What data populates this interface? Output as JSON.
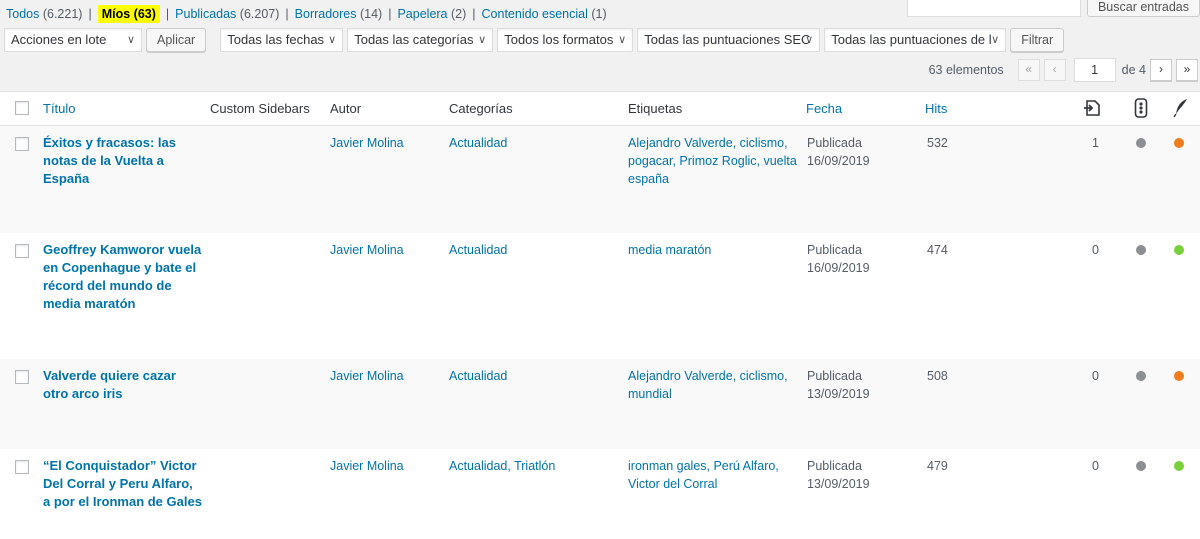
{
  "status_filters": [
    {
      "label": "Todos",
      "count": "(6.221)",
      "current": false
    },
    {
      "label": "Míos",
      "count": "(63)",
      "current": true
    },
    {
      "label": "Publicadas",
      "count": "(6.207)",
      "current": false
    },
    {
      "label": "Borradores",
      "count": "(14)",
      "current": false
    },
    {
      "label": "Papelera",
      "count": "(2)",
      "current": false
    },
    {
      "label": "Contenido esencial",
      "count": "(1)",
      "current": false
    }
  ],
  "search": {
    "placeholder": "",
    "button": "Buscar entradas"
  },
  "filters": {
    "bulk_action": "Acciones en lote",
    "apply": "Aplicar",
    "dates": "Todas las fechas",
    "categories": "Todas las categorías",
    "formats": "Todos los formatos",
    "seo_scores": "Todas las puntuaciones SEC",
    "readability_scores": "Todas las puntuaciones de l",
    "filter_button": "Filtrar"
  },
  "pagination": {
    "items": "63 elementos",
    "first": "«",
    "prev": "‹",
    "current_page": "1",
    "of_pages": "de 4",
    "next": "›",
    "last": "»"
  },
  "columns": {
    "title": "Título",
    "sidebars": "Custom Sidebars",
    "author": "Autor",
    "categories": "Categorías",
    "tags": "Etiquetas",
    "date": "Fecha",
    "hits": "Hits"
  },
  "icons": {
    "links_column": "internal-links-icon",
    "seo_column": "traffic-light-icon",
    "readability_column": "quill-icon"
  },
  "status_colors": {
    "gray": "#8c8f94",
    "orange": "#ee7c1b",
    "green": "#7ad03a"
  },
  "rows": [
    {
      "title": [
        "Éxitos y fracasos: las",
        "notas de la Vuelta a",
        "España"
      ],
      "author": "Javier Molina",
      "categories": "Actualidad",
      "tags": [
        "Alejandro Valverde, ciclismo,",
        "pogacar, Primoz Roglic, vuelta",
        "españa"
      ],
      "date_status": "Publicada",
      "date": "16/09/2019",
      "hits": "532",
      "links": "1",
      "seo": "gray",
      "readability": "orange"
    },
    {
      "title": [
        "Geoffrey Kamworor vuela",
        "en Copenhague y bate el",
        "récord del mundo de",
        "media maratón"
      ],
      "author": "Javier Molina",
      "categories": "Actualidad",
      "tags": [
        "media maratón"
      ],
      "date_status": "Publicada",
      "date": "16/09/2019",
      "hits": "474",
      "links": "0",
      "seo": "gray",
      "readability": "green"
    },
    {
      "title": [
        "Valverde quiere cazar",
        "otro arco iris"
      ],
      "author": "Javier Molina",
      "categories": "Actualidad",
      "tags": [
        "Alejandro Valverde, ciclismo,",
        "mundial"
      ],
      "date_status": "Publicada",
      "date": "13/09/2019",
      "hits": "508",
      "links": "0",
      "seo": "gray",
      "readability": "orange"
    },
    {
      "title": [
        "“El Conquistador” Victor",
        "Del Corral y Peru Alfaro,",
        "a por el Ironman de Gales"
      ],
      "author": "Javier Molina",
      "categories": "Actualidad, Triatlón",
      "tags": [
        "ironman gales, Perú Alfaro,",
        "Victor del Corral"
      ],
      "date_status": "Publicada",
      "date": "13/09/2019",
      "hits": "479",
      "links": "0",
      "seo": "gray",
      "readability": "green"
    }
  ]
}
